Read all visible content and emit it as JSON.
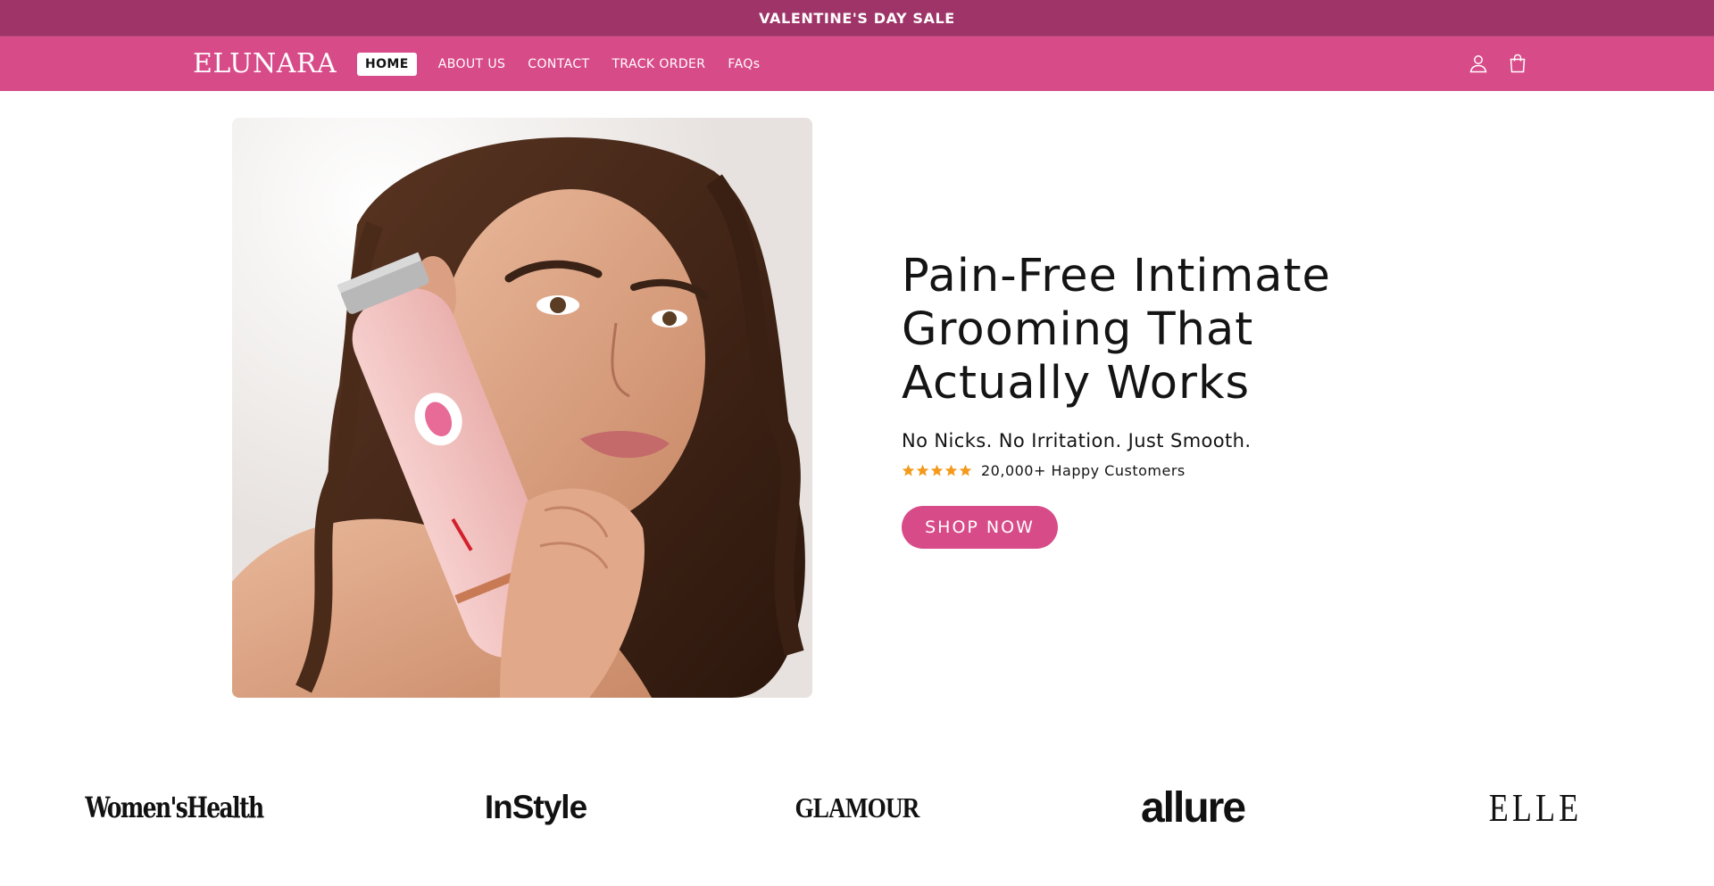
{
  "announcement": {
    "text": "VALENTINE'S DAY SALE"
  },
  "header": {
    "logo": "ELUNARA",
    "nav": [
      {
        "label": "HOME",
        "active": true
      },
      {
        "label": "ABOUT US",
        "active": false
      },
      {
        "label": "CONTACT",
        "active": false
      },
      {
        "label": "TRACK ORDER",
        "active": false
      },
      {
        "label": "FAQs",
        "active": false
      }
    ],
    "icons": [
      "account-icon",
      "cart-icon"
    ]
  },
  "hero": {
    "image_description_icon": "product-photo",
    "title_line_1": "Pain-Free Intimate",
    "title_line_2": "Grooming That",
    "title_line_3": "Actually Works",
    "subtitle": "No Nicks. No Irritation. Just Smooth.",
    "rating": {
      "stars": 5,
      "text": "20,000+ Happy Customers"
    },
    "cta_label": "SHOP NOW"
  },
  "press": {
    "logos": [
      "Women'sHealth",
      "InStyle",
      "GLAMOUR",
      "allure",
      "ELLE"
    ]
  },
  "colors": {
    "announcement_bg": "#9e3467",
    "header_bg": "#d84b89",
    "cta_bg": "#d84b89",
    "star": "#f39a1b"
  }
}
